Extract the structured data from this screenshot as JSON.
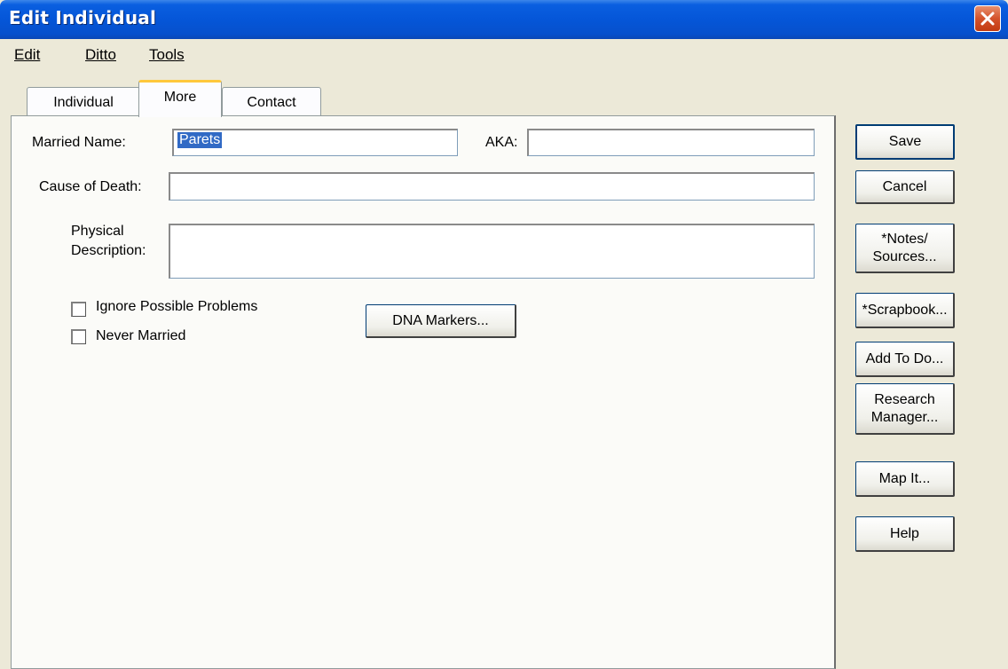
{
  "window": {
    "title": "Edit Individual"
  },
  "menu": [
    {
      "label": "Edit"
    },
    {
      "label": "Ditto"
    },
    {
      "label": "Tools"
    }
  ],
  "tabs": [
    {
      "label": "Individual",
      "active": false
    },
    {
      "label": "More",
      "active": true
    },
    {
      "label": "Contact",
      "active": false
    }
  ],
  "form": {
    "married_name_label": "Married Name:",
    "married_name_value": "Parets",
    "aka_label": "AKA:",
    "aka_value": "",
    "cause_of_death_label": "Cause of Death:",
    "cause_of_death_value": "",
    "physical_description_label_line1": "Physical",
    "physical_description_label_line2": "Description:",
    "physical_description_value": "",
    "ignore_problems_label": "Ignore Possible Problems",
    "ignore_problems_checked": false,
    "never_married_label": "Never Married",
    "never_married_checked": false,
    "dna_markers_button": "DNA Markers..."
  },
  "side_buttons": {
    "save": "Save",
    "cancel": "Cancel",
    "notes_line1": "*Notes/",
    "notes_line2": "Sources...",
    "scrapbook": "*Scrapbook...",
    "add_todo": "Add To Do...",
    "research_line1": "Research",
    "research_line2": "Manager...",
    "map_it": "Map It...",
    "help": "Help"
  },
  "colors": {
    "titlebar": "#0556d8",
    "selection": "#316ac5",
    "close_button": "#d4522b",
    "dialog_bg": "#ece9d8"
  }
}
